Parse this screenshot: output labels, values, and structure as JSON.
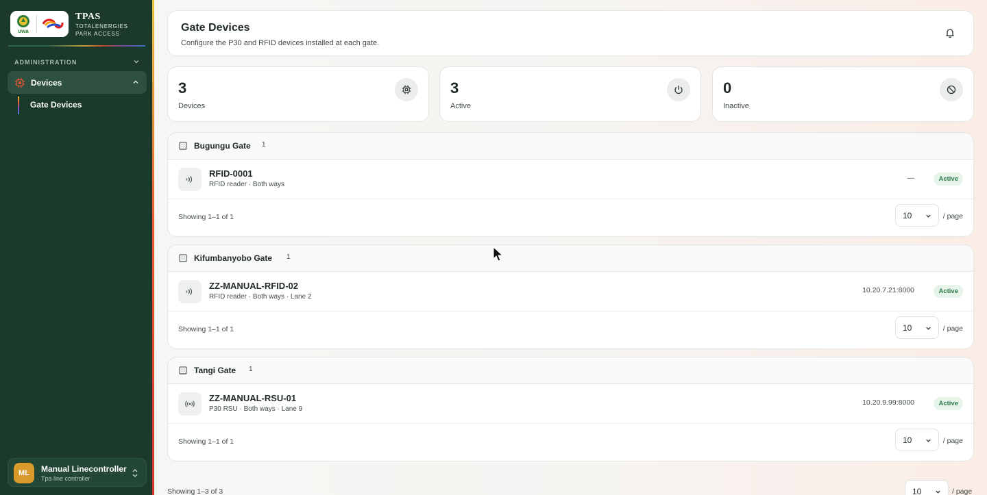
{
  "brand": {
    "title": "TPAS",
    "subtitle": "TOTALENERGIES PARK ACCESS",
    "uwa_text": "UWA"
  },
  "sidebar": {
    "section_label": "ADMINISTRATION",
    "group_label": "Devices",
    "items": [
      {
        "label": "Gate Devices"
      }
    ]
  },
  "user": {
    "initials": "ML",
    "name": "Manual Linecontroller",
    "role": "Tpa line controller"
  },
  "header": {
    "title": "Gate Devices",
    "subtitle": "Configure the P30 and RFID devices installed at each gate."
  },
  "stats": [
    {
      "value": "3",
      "label": "Devices",
      "icon": "chip-icon"
    },
    {
      "value": "3",
      "label": "Active",
      "icon": "power-icon"
    },
    {
      "value": "0",
      "label": "Inactive",
      "icon": "ban-icon"
    }
  ],
  "gates": [
    {
      "name": "Bugungu Gate",
      "count": "1",
      "device": {
        "name": "RFID-0001",
        "meta": "RFID reader · Both ways",
        "address": "—",
        "status": "Active",
        "icon": "rfid-icon"
      },
      "showing": "Showing 1–1 of 1",
      "per_page": "10",
      "per_label": "/ page"
    },
    {
      "name": "Kifumbanyobo Gate",
      "count": "1",
      "device": {
        "name": "ZZ-MANUAL-RFID-02",
        "meta": "RFID reader · Both ways · Lane 2",
        "address": "10.20.7.21:8000",
        "status": "Active",
        "icon": "rfid-icon"
      },
      "showing": "Showing 1–1 of 1",
      "per_page": "10",
      "per_label": "/ page"
    },
    {
      "name": "Tangi Gate",
      "count": "1",
      "device": {
        "name": "ZZ-MANUAL-RSU-01",
        "meta": "P30 RSU · Both ways · Lane 9",
        "address": "10.20.9.99:8000",
        "status": "Active",
        "icon": "broadcast-icon"
      },
      "showing": "Showing 1–1 of 1",
      "per_page": "10",
      "per_label": "/ page"
    }
  ],
  "footer": {
    "showing": "Showing 1–3 of 3",
    "per_page": "10",
    "per_label": "/ page"
  },
  "colors": {
    "sidebar": "#1c3a2c",
    "accent_active": "#2e7a4a",
    "avatar": "#d99a2b"
  }
}
